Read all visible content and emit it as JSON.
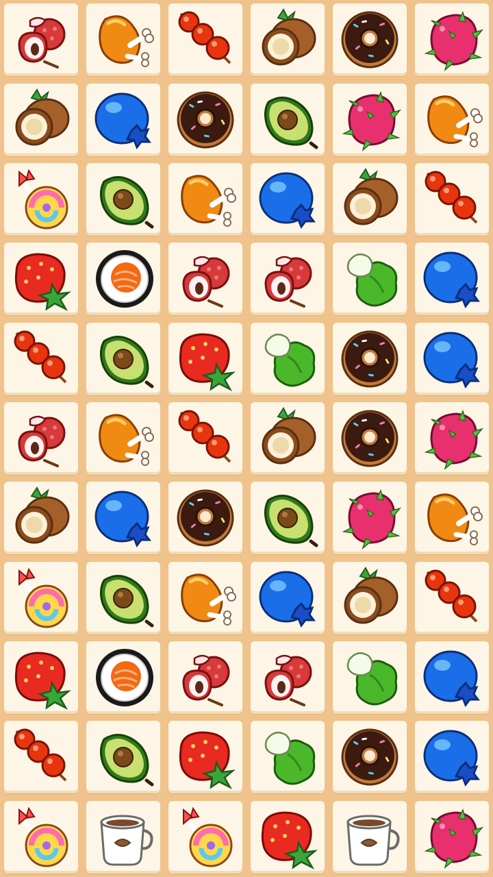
{
  "game": {
    "columns": 6,
    "rows": 11,
    "grid": [
      [
        "lychee",
        "roast-chicken",
        "candied-hawthorn",
        "coconut",
        "chocolate-donut",
        "dragon-fruit"
      ],
      [
        "coconut",
        "blueberry",
        "chocolate-donut",
        "avocado",
        "dragon-fruit",
        "roast-chicken"
      ],
      [
        "lollipop",
        "avocado",
        "roast-chicken",
        "blueberry",
        "coconut",
        "candied-hawthorn"
      ],
      [
        "strawberry",
        "sushi-roll",
        "lychee",
        "lychee",
        "lettuce",
        "blueberry"
      ],
      [
        "candied-hawthorn",
        "avocado",
        "strawberry",
        "lettuce",
        "chocolate-donut",
        "blueberry"
      ],
      [
        "lychee",
        "roast-chicken",
        "candied-hawthorn",
        "coconut",
        "chocolate-donut",
        "dragon-fruit"
      ],
      [
        "coconut",
        "blueberry",
        "chocolate-donut",
        "avocado",
        "dragon-fruit",
        "roast-chicken"
      ],
      [
        "lollipop",
        "avocado",
        "roast-chicken",
        "blueberry",
        "coconut",
        "candied-hawthorn"
      ],
      [
        "strawberry",
        "sushi-roll",
        "lychee",
        "lychee",
        "lettuce",
        "blueberry"
      ],
      [
        "candied-hawthorn",
        "avocado",
        "strawberry",
        "lettuce",
        "chocolate-donut",
        "blueberry"
      ],
      [
        "lollipop",
        "coffee-cup",
        "lollipop",
        "strawberry",
        "coffee-cup",
        "dragon-fruit"
      ]
    ]
  }
}
